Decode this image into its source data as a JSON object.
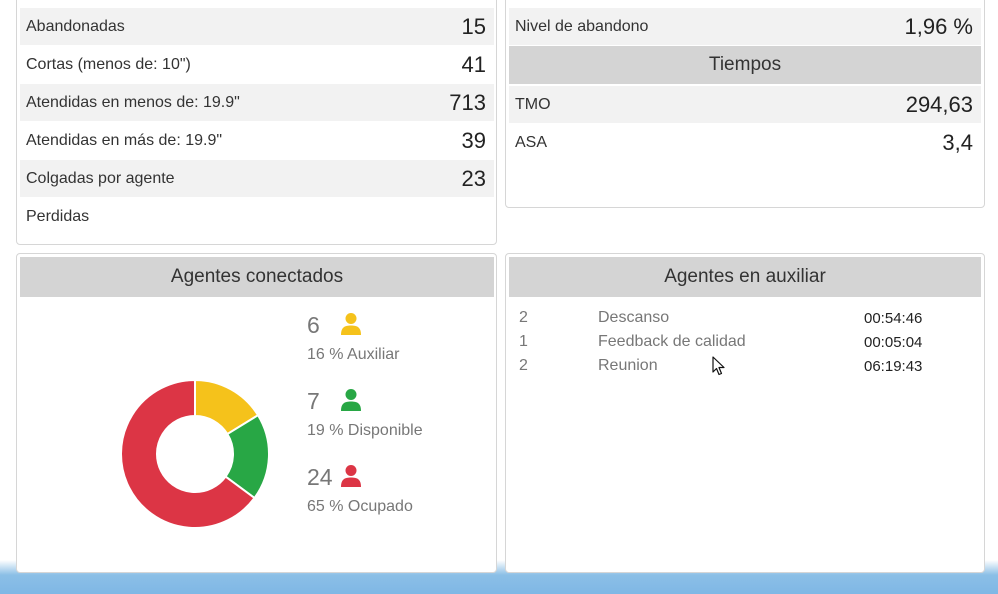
{
  "calls": {
    "rows": [
      {
        "label": "Abandonadas",
        "value": "15"
      },
      {
        "label": "Cortas (menos de: 10\")",
        "value": "41"
      },
      {
        "label": "Atendidas en menos de: 19.9\"",
        "value": "713"
      },
      {
        "label": "Atendidas en más de: 19.9\"",
        "value": "39"
      },
      {
        "label": "Colgadas por agente",
        "value": "23"
      },
      {
        "label": "Perdidas",
        "value": ""
      }
    ]
  },
  "levels": {
    "abandon_label": "Nivel de abandono",
    "abandon_value": "1,96 %",
    "times_header": "Tiempos",
    "times": [
      {
        "label": "TMO",
        "value": "294,63"
      },
      {
        "label": "ASA",
        "value": "3,4"
      }
    ]
  },
  "agents_connected": {
    "header": "Agentes conectados",
    "legend": [
      {
        "count": "6",
        "pct": "16 % Auxiliar",
        "color": "#f5c21b",
        "icon": "person-icon"
      },
      {
        "count": "7",
        "pct": "19 % Disponible",
        "color": "#28a745",
        "icon": "person-icon"
      },
      {
        "count": "24",
        "pct": "65 % Ocupado",
        "color": "#dc3545",
        "icon": "person-icon"
      }
    ],
    "chart_data": {
      "type": "pie",
      "categories": [
        "Auxiliar",
        "Disponible",
        "Ocupado"
      ],
      "values": [
        6,
        7,
        24
      ],
      "colors": [
        "#f5c21b",
        "#28a745",
        "#dc3545"
      ],
      "title": ""
    }
  },
  "agents_aux": {
    "header": "Agentes en auxiliar",
    "rows": [
      {
        "count": "2",
        "reason": "Descanso",
        "time": "00:54:46"
      },
      {
        "count": "1",
        "reason": "Feedback de calidad",
        "time": "00:05:04"
      },
      {
        "count": "2",
        "reason": "Reunion",
        "time": "06:19:43"
      }
    ]
  }
}
